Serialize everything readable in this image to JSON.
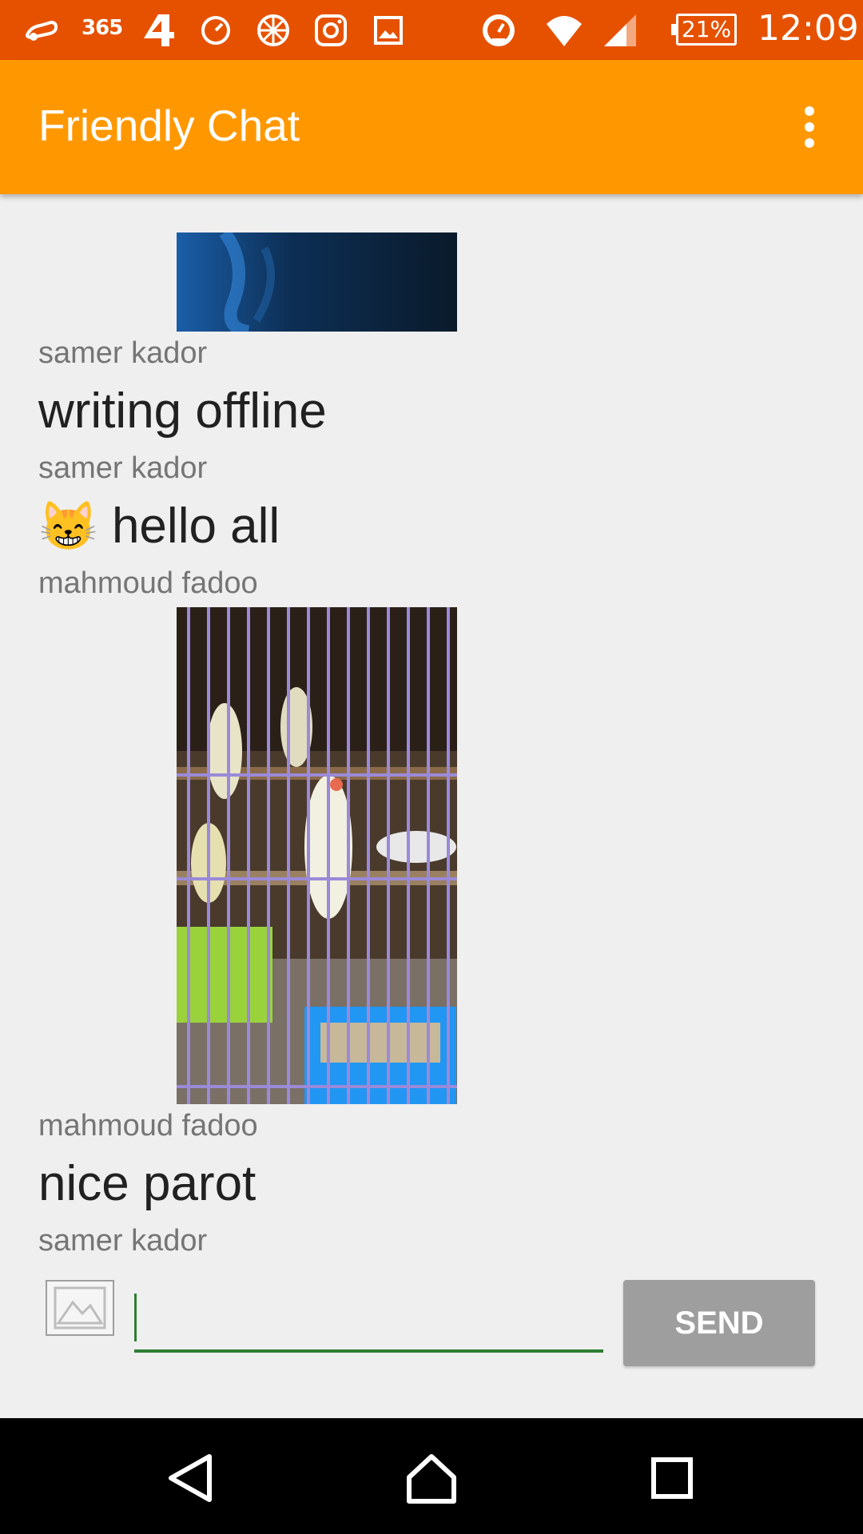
{
  "status_bar": {
    "app_icons": [
      "scooter-icon",
      "365-icon",
      "four-icon",
      "speedometer-icon",
      "globe-icon",
      "instagram-icon",
      "gallery-icon",
      "gauge-icon",
      "wifi-icon",
      "signal-icon"
    ],
    "label_365": "365",
    "battery": "21%",
    "time": "12:09"
  },
  "app_bar": {
    "title": "Friendly Chat",
    "overflow_icon": "more-vert-icon"
  },
  "messages": [
    {
      "type": "image",
      "description_icon": "photo-icon"
    },
    {
      "sender": "samer kador",
      "text": "writing offline"
    },
    {
      "sender": "samer kador",
      "text": "hello all",
      "emoji": "😸"
    },
    {
      "sender": "mahmoud fadoo",
      "type": "image"
    },
    {
      "sender": "mahmoud fadoo",
      "text": "nice parot"
    },
    {
      "sender": "samer kador"
    }
  ],
  "input": {
    "value": "",
    "placeholder": "",
    "send_label": "SEND",
    "image_button_icon": "add-image-icon"
  },
  "nav_bar": {
    "icons": [
      "back-icon",
      "home-icon",
      "recents-icon"
    ]
  },
  "colors": {
    "status_bar": "#e65100",
    "app_bar": "#ff9800",
    "accent_underline": "#2e7d32",
    "send_button": "#9e9e9e"
  }
}
